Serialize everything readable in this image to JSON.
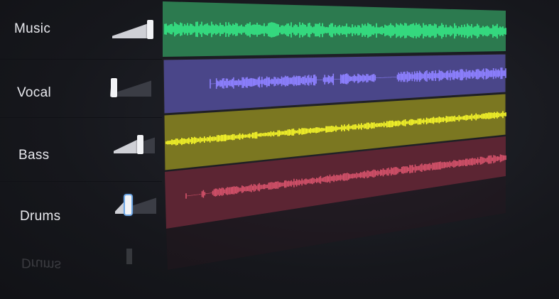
{
  "tracks": [
    {
      "name": "Music",
      "volume": 0.95,
      "color": "#2e7d4f",
      "wave": "#37f08a"
    },
    {
      "name": "Vocal",
      "volume": 0.0,
      "color": "#4a4688",
      "wave": "#8d80ff"
    },
    {
      "name": "Bass",
      "volume": 0.75,
      "color": "#7c7722",
      "wave": "#ffff2a"
    },
    {
      "name": "Drums",
      "volume": 0.35,
      "color": "#5e2733",
      "wave": "#d8536c"
    }
  ],
  "reflection_label": "Drums"
}
